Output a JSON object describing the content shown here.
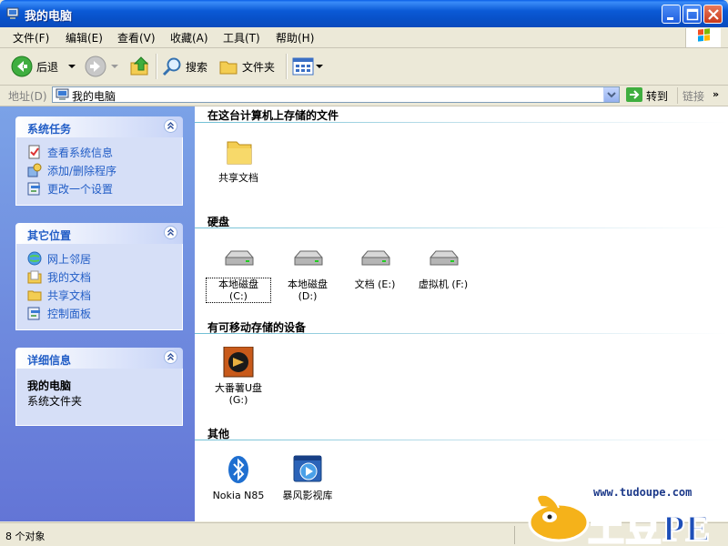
{
  "window": {
    "title": "我的电脑"
  },
  "menu": [
    "文件(F)",
    "编辑(E)",
    "查看(V)",
    "收藏(A)",
    "工具(T)",
    "帮助(H)"
  ],
  "toolbar": {
    "back": "后退",
    "search": "搜索",
    "folders": "文件夹"
  },
  "address": {
    "label": "地址(D)",
    "value": "我的电脑",
    "go": "转到",
    "links": "链接"
  },
  "leftpane": {
    "system_tasks": {
      "title": "系统任务",
      "items": [
        "查看系统信息",
        "添加/删除程序",
        "更改一个设置"
      ]
    },
    "other_places": {
      "title": "其它位置",
      "items": [
        "网上邻居",
        "我的文档",
        "共享文档",
        "控制面板"
      ]
    },
    "details": {
      "title": "详细信息",
      "name": "我的电脑",
      "type": "系统文件夹"
    }
  },
  "content": {
    "sections": [
      {
        "title": "在这台计算机上存储的文件",
        "items": [
          "共享文档"
        ]
      },
      {
        "title": "硬盘",
        "items": [
          "本地磁盘\n(C:)",
          "本地磁盘\n(D:)",
          "文档 (E:)",
          "虚拟机 (F:)"
        ]
      },
      {
        "title": "有可移动存储的设备",
        "items": [
          "大番薯U盘\n(G:)"
        ]
      },
      {
        "title": "其他",
        "items": [
          "Nokia N85",
          "暴风影视库"
        ]
      }
    ]
  },
  "status": {
    "text": "8 个对象"
  },
  "watermark": {
    "url": "www.tudoupe.com",
    "brand": "土豆PE"
  },
  "colors": {
    "titlebar": "#0b5ad6",
    "link_blue": "#215dc6",
    "left_pane": "#7ba2e7"
  }
}
